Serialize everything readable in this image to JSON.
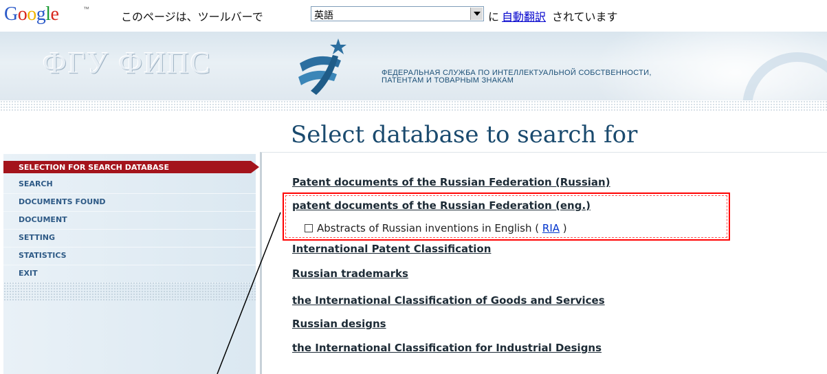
{
  "translate_bar": {
    "logo": "Google",
    "tm": "™",
    "message_prefix": "このページは、ツールバーで",
    "language_value": "英語",
    "message_mid": "に",
    "link": "自動翻訳",
    "message_suffix": "されています"
  },
  "banner": {
    "title": "ФГУ ФИПС",
    "desc_line1": "ФЕДЕРАЛЬНАЯ СЛУЖБА ПО ИНТЕЛЛЕКТУАЛЬНОЙ СОБСТВЕННОСТИ,",
    "desc_line2": "ПАТЕНТАМ И ТОВАРНЫМ ЗНАКАМ",
    "emblem_icon": "fips-emblem-icon"
  },
  "page_title": "Select database to search for",
  "sidebar": {
    "active": "SELECTION FOR SEARCH DATABASE",
    "items": [
      {
        "label": "SEARCH"
      },
      {
        "label": "DOCUMENTS FOUND"
      },
      {
        "label": "DOCUMENT"
      },
      {
        "label": "SETTING"
      },
      {
        "label": "STATISTICS"
      },
      {
        "label": "EXIT"
      }
    ]
  },
  "databases": [
    {
      "label": "Patent documents of the Russian Federation (Russian)"
    },
    {
      "label": "patent documents of the Russian Federation (eng.)"
    },
    {
      "label": "International Patent Classification"
    },
    {
      "label": "Russian trademarks"
    },
    {
      "label": "the International Classification of Goods and Services"
    },
    {
      "label": "Russian designs"
    },
    {
      "label": "the International Classification for Industrial Designs"
    }
  ],
  "abstracts_option": {
    "label": "Abstracts of Russian inventions in English (",
    "link": "RIA",
    "close": ")",
    "checked": false
  },
  "colors": {
    "active_nav": "#a4141c",
    "nav_text": "#2e5a86",
    "title": "#1a4a6e",
    "highlight": "#ff0000"
  }
}
